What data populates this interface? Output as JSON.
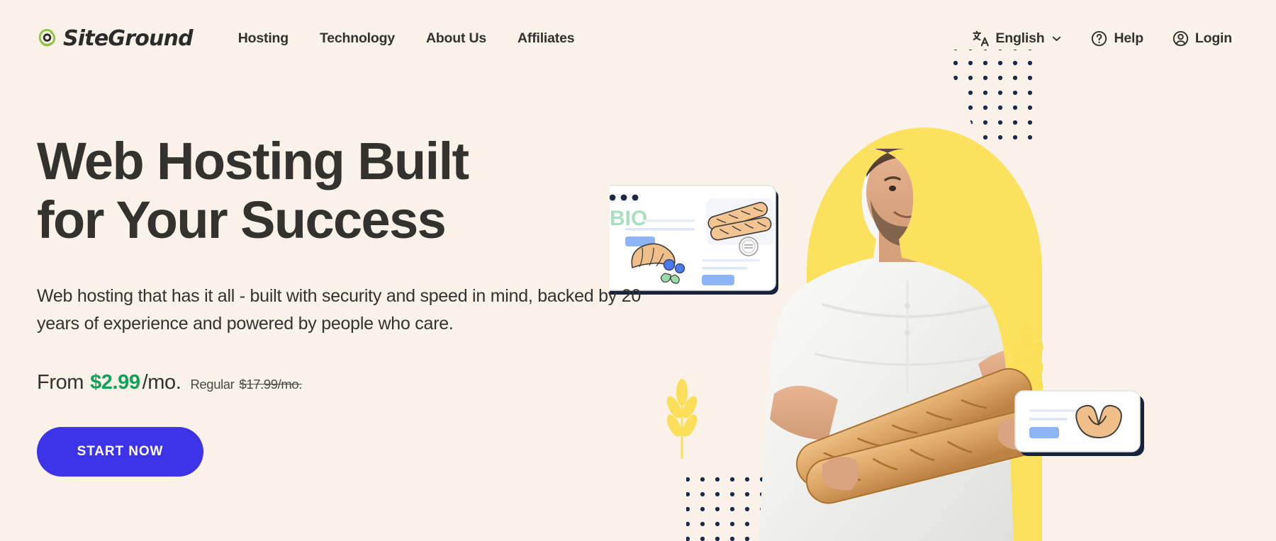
{
  "brand": {
    "name": "SiteGround",
    "logo_icon": "siteground-swirl-icon",
    "accent_green": "#8CC63F",
    "text_dark": "#33322F"
  },
  "header": {
    "nav": [
      {
        "label": "Hosting"
      },
      {
        "label": "Technology"
      },
      {
        "label": "About Us"
      },
      {
        "label": "Affiliates"
      }
    ],
    "utility": {
      "language": {
        "label": "English",
        "icon": "translate-icon",
        "chevron": "chevron-down-icon"
      },
      "help": {
        "label": "Help",
        "icon": "question-circle-icon"
      },
      "login": {
        "label": "Login",
        "icon": "user-circle-icon"
      }
    }
  },
  "hero": {
    "headline_line1": "Web Hosting Built",
    "headline_line2": "for Your Success",
    "subheadline": "Web hosting that has it all - built with security and speed in mind, backed by 20 years of experience and powered by people who care.",
    "price": {
      "from_label": "From",
      "amount": "$2.99",
      "period": "/mo.",
      "regular_label": "Regular",
      "regular_price": "$17.99/mo."
    },
    "cta_label": "START NOW",
    "colors": {
      "background": "#FAF1E9",
      "price_green": "#13A05A",
      "cta_blue": "#3D33E8",
      "arch_yellow": "#FBE15E",
      "dot_navy": "#1B2A4A",
      "wheat_yellow": "#FBDF58",
      "card_blue": "#8DB4F7",
      "bio_green": "#A8E0BF"
    },
    "illustration": {
      "photo_subject": "bearded-baker-holding-baguettes",
      "browser_card": {
        "label": "BIO",
        "items": [
          "baguette-illustration",
          "croissant-illustration",
          "blueberry-illustration",
          "stamp-badge-icon"
        ]
      },
      "small_card": {
        "item": "pretzel-illustration"
      },
      "decorations": [
        "wheat-stalk",
        "dot-grid",
        "yellow-arch"
      ]
    }
  }
}
